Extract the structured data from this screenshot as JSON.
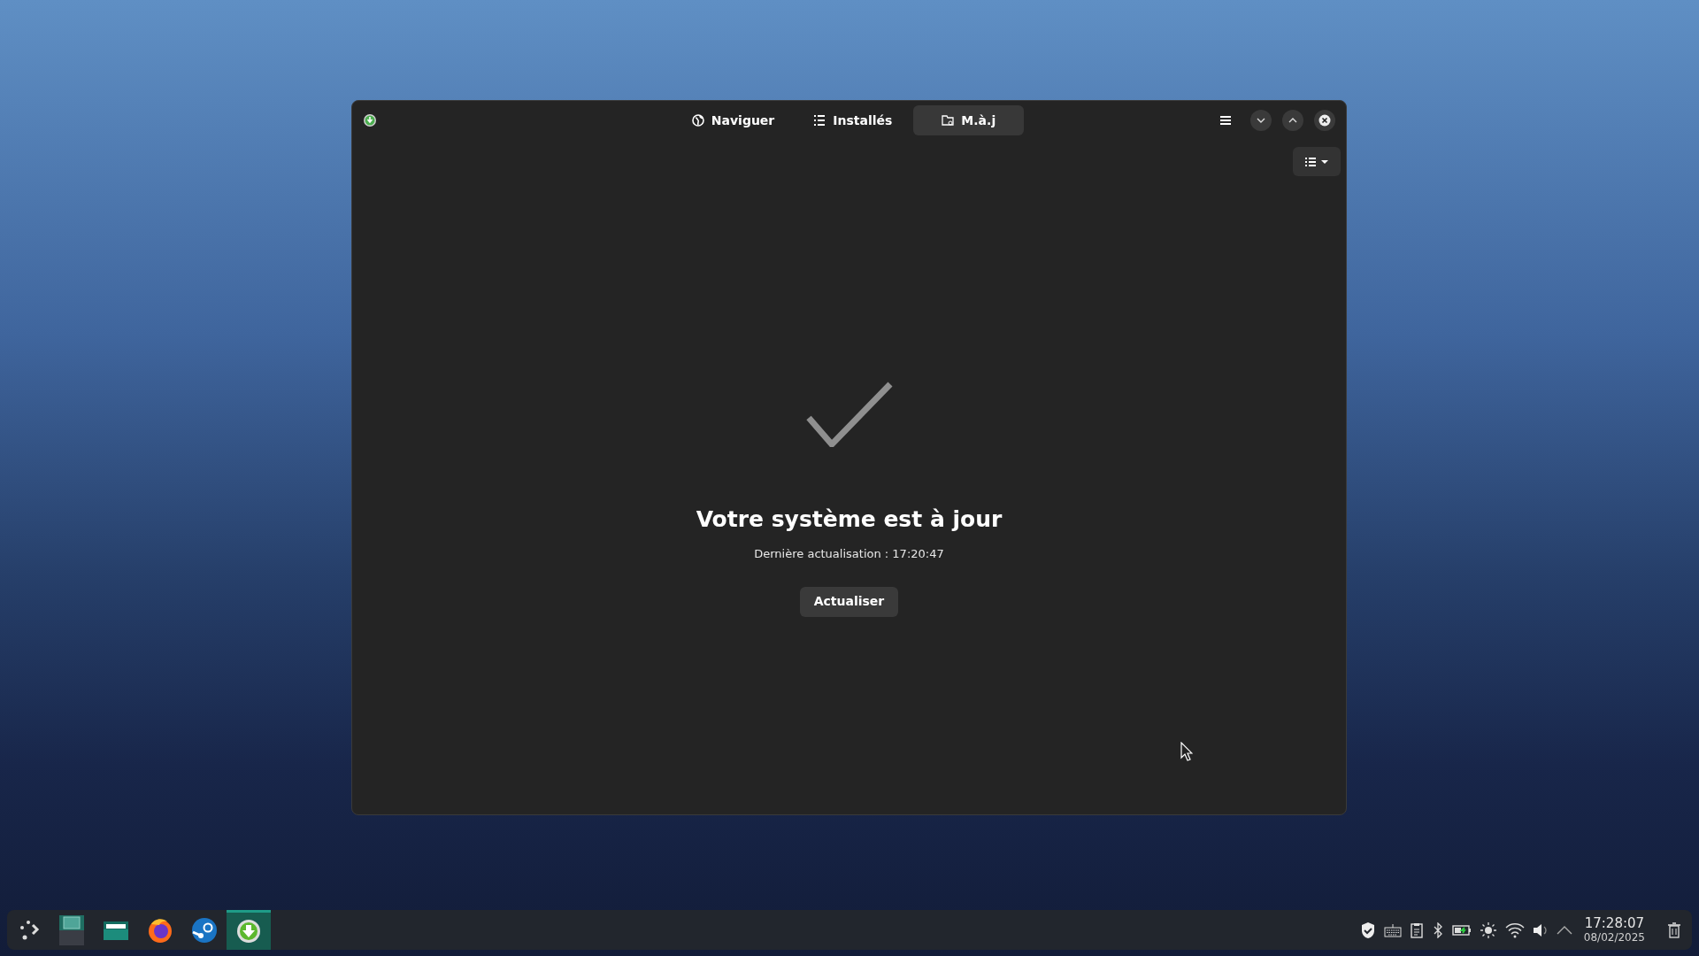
{
  "window": {
    "tabs": [
      {
        "label": "Naviguer",
        "selected": false
      },
      {
        "label": "Installés",
        "selected": false
      },
      {
        "label": "M.à.j",
        "selected": true
      }
    ],
    "status": {
      "title": "Votre système est à jour",
      "subtitle": "Dernière actualisation : 17:20:47",
      "button": "Actualiser"
    }
  },
  "taskbar": {
    "apps": [
      {
        "kind": "pager",
        "selected": false
      },
      {
        "kind": "files",
        "selected": false
      },
      {
        "kind": "browser",
        "selected": false
      },
      {
        "kind": "steam",
        "selected": false
      },
      {
        "kind": "updater",
        "selected": true
      }
    ],
    "clock": {
      "time": "17:28:07",
      "date": "08/02/2025"
    }
  }
}
